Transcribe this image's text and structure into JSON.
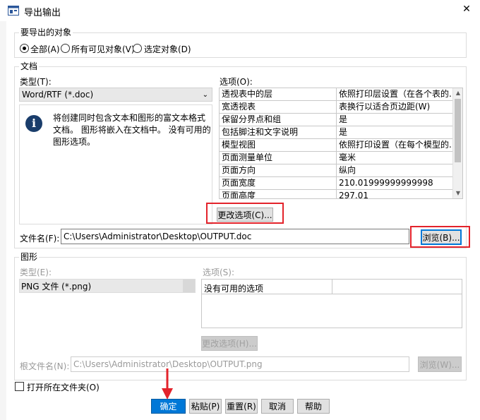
{
  "window": {
    "title": "导出输出",
    "close_glyph": "✕"
  },
  "export_objects": {
    "legend": "要导出的对象",
    "options": [
      {
        "label": "全部(A)",
        "checked": true
      },
      {
        "label": "所有可见对象(V)",
        "checked": false
      },
      {
        "label": "选定对象(D)",
        "checked": false
      }
    ]
  },
  "document": {
    "legend": "文档",
    "type_label": "类型(T):",
    "type_value": "Word/RTF (*.doc)",
    "info_text": "将创建同时包含文本和图形的富文本格式文档。 图形将嵌入在文档中。 没有可用的图形选项。",
    "options_label": "选项(O):",
    "options": [
      {
        "name": "透视表中的层",
        "value": "依照打印层设置（在各个表的..."
      },
      {
        "name": "宽透视表",
        "value": "表换行以适合页边距(W)"
      },
      {
        "name": "保留分界点和组",
        "value": "是"
      },
      {
        "name": "包括脚注和文字说明",
        "value": "是"
      },
      {
        "name": "模型视图",
        "value": "依照打印设置（在每个模型的..."
      },
      {
        "name": "页面测量单位",
        "value": "毫米"
      },
      {
        "name": "页面方向",
        "value": "纵向"
      },
      {
        "name": "页面宽度",
        "value": "210.01999999999998"
      },
      {
        "name": "页面高度",
        "value": "297.01"
      }
    ],
    "change_options_button": "更改选项(C)...",
    "file_name_label": "文件名(F):",
    "file_name_value": "C:\\Users\\Administrator\\Desktop\\OUTPUT.doc",
    "browse_button": "浏览(B)..."
  },
  "graphics": {
    "legend": "图形",
    "type_label": "类型(E):",
    "type_value": "PNG 文件 (*.png)",
    "options_label": "选项(S):",
    "options_placeholder": "没有可用的选项",
    "change_options_button": "更改选项(H)...",
    "root_file_label": "根文件名(N):",
    "root_file_value": "C:\\Users\\Administrator\\Desktop\\OUTPUT.png",
    "browse_button": "浏览(W)..."
  },
  "open_folder": {
    "label": "打开所在文件夹(O)",
    "checked": false
  },
  "footer_buttons": {
    "ok": "确定",
    "paste": "粘贴(P)",
    "reset": "重置(R)",
    "cancel": "取消",
    "help": "帮助"
  },
  "colors": {
    "highlight": "#e3232b",
    "accent": "#0078d7"
  }
}
